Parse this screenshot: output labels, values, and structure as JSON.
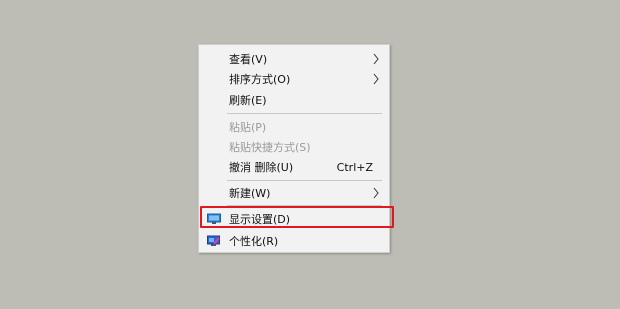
{
  "menu": {
    "items": [
      {
        "label": "查看(V)",
        "submenu": true
      },
      {
        "label": "排序方式(O)",
        "submenu": true
      },
      {
        "label": "刷新(E)"
      },
      {
        "label": "粘贴(P)",
        "disabled": true
      },
      {
        "label": "粘贴快捷方式(S)",
        "disabled": true
      },
      {
        "label": "撤消 删除(U)",
        "shortcut": "Ctrl+Z"
      },
      {
        "label": "新建(W)",
        "submenu": true
      },
      {
        "label": "显示设置(D)",
        "icon": "display-settings-icon",
        "highlighted": true
      },
      {
        "label": "个性化(R)",
        "icon": "personalize-icon"
      }
    ]
  },
  "colors": {
    "highlight_border": "#e1191f",
    "menu_background": "#f2f2f2",
    "desktop_background": "#bdbdb5"
  }
}
